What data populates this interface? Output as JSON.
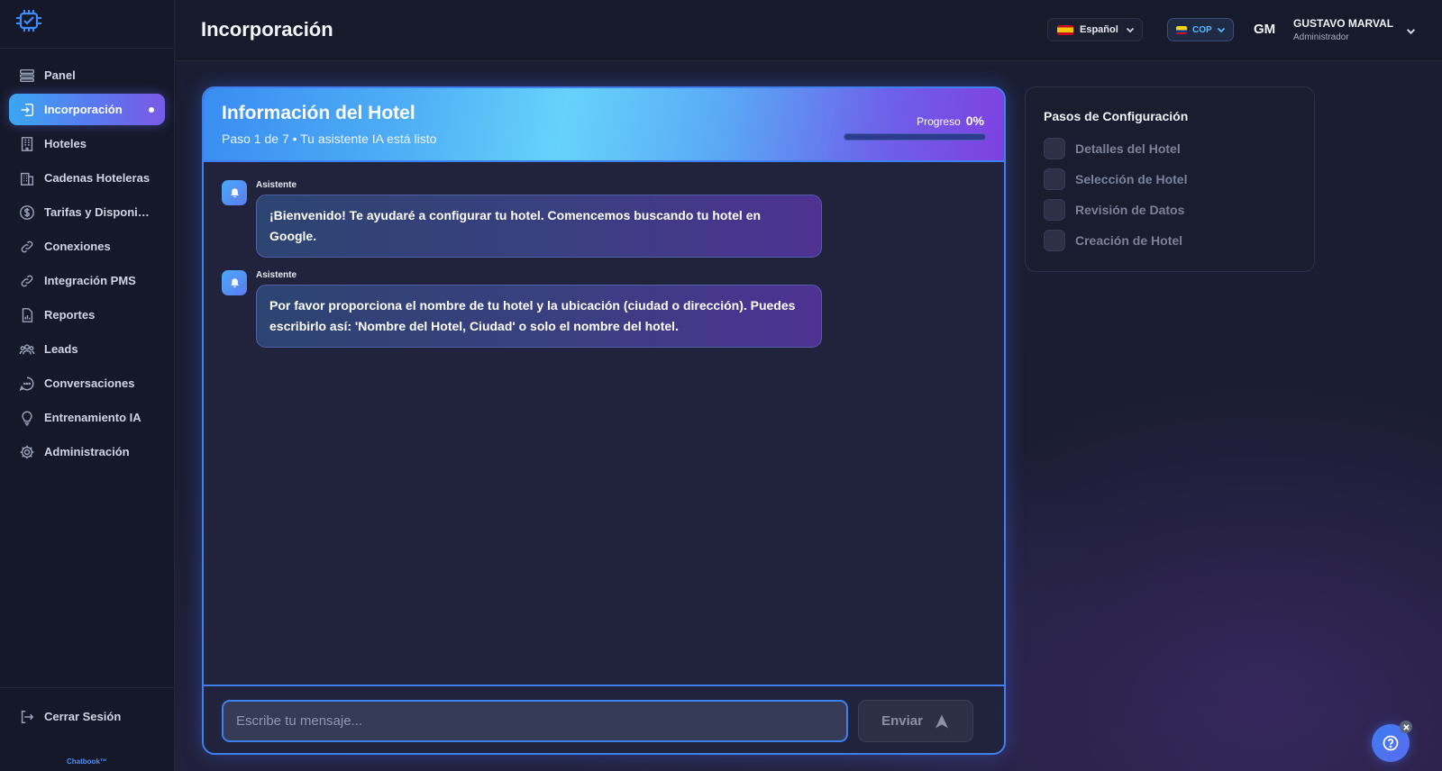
{
  "header": {
    "title": "Incorporación",
    "language": {
      "label": "Español",
      "flag_icon": "spain-flag-icon"
    },
    "currency": {
      "label": "COP",
      "flag_icon": "colombia-flag-icon"
    },
    "user": {
      "initials": "GM",
      "name": "GUSTAVO MARVAL",
      "role": "Administrador"
    }
  },
  "sidebar": {
    "items": [
      {
        "label": "Panel",
        "icon": "dashboard-icon"
      },
      {
        "label": "Incorporación",
        "icon": "login-icon",
        "active": true
      },
      {
        "label": "Hoteles",
        "icon": "building-icon"
      },
      {
        "label": "Cadenas Hoteleras",
        "icon": "buildings-icon"
      },
      {
        "label": "Tarifas y Disponibilidad",
        "icon": "dollar-icon"
      },
      {
        "label": "Conexiones",
        "icon": "link-icon"
      },
      {
        "label": "Integración PMS",
        "icon": "link-icon"
      },
      {
        "label": "Reportes",
        "icon": "report-icon"
      },
      {
        "label": "Leads",
        "icon": "users-icon"
      },
      {
        "label": "Conversaciones",
        "icon": "chat-icon"
      },
      {
        "label": "Entrenamiento IA",
        "icon": "lightbulb-icon"
      },
      {
        "label": "Administración",
        "icon": "gear-icon"
      }
    ],
    "logout_label": "Cerrar Sesión",
    "brand": "Chatbook™"
  },
  "chat": {
    "title": "Información del Hotel",
    "subtitle": "Paso 1 de 7 • Tu asistente IA está listo",
    "progress_label": "Progreso",
    "progress_value": "0%",
    "progress_fraction": 0,
    "messages": [
      {
        "sender": "Asistente",
        "text": "¡Bienvenido! Te ayudaré a configurar tu hotel. Comencemos buscando tu hotel en Google."
      },
      {
        "sender": "Asistente",
        "text": "Por favor proporciona el nombre de tu hotel y la ubicación (ciudad o dirección). Puedes escribirlo así: 'Nombre del Hotel, Ciudad' o solo el nombre del hotel."
      }
    ],
    "input_placeholder": "Escribe tu mensaje...",
    "send_label": "Enviar"
  },
  "steps": {
    "title": "Pasos de Configuración",
    "items": [
      "Detalles del Hotel",
      "Selección de Hotel",
      "Revisión de Datos",
      "Creación de Hotel"
    ]
  },
  "colors": {
    "accent": "#3f7ff0",
    "active_gradient_start": "#3aa7f3",
    "active_gradient_end": "#7a5ae6"
  }
}
